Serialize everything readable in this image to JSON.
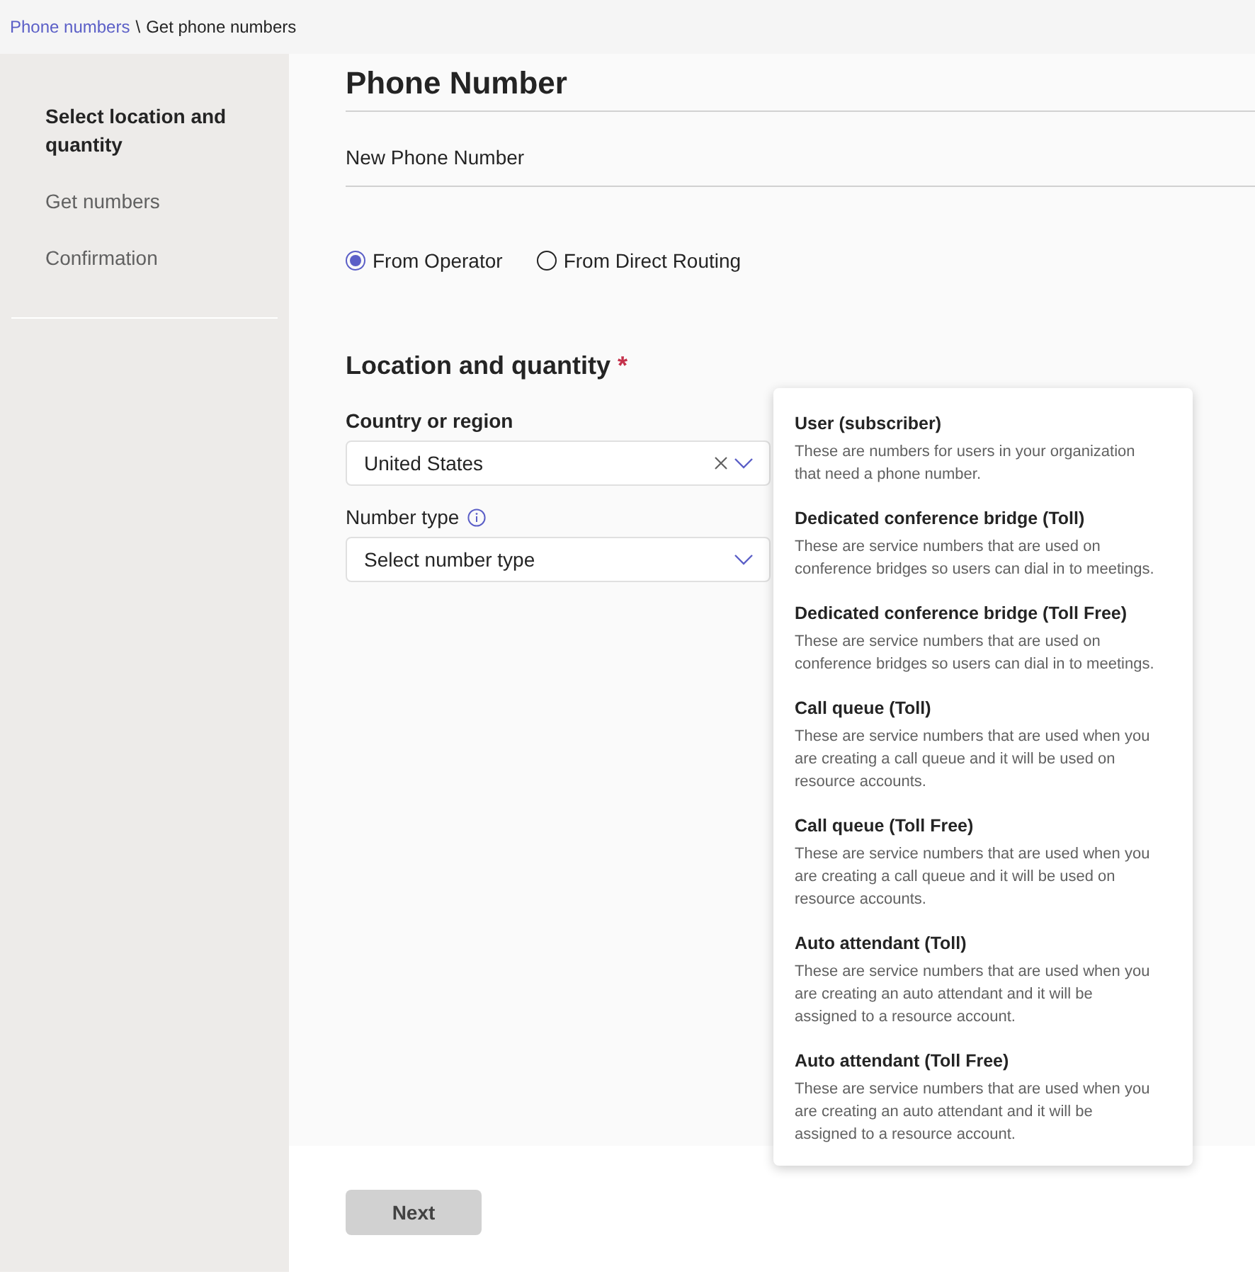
{
  "breadcrumb": {
    "link": "Phone numbers",
    "separator": "\\",
    "current": "Get phone numbers"
  },
  "steps": [
    {
      "label": "Select location and quantity",
      "selected": true
    },
    {
      "label": "Get numbers",
      "selected": false
    },
    {
      "label": "Confirmation",
      "selected": false
    }
  ],
  "page_title": "Phone Number",
  "subtitle": "New Phone Number",
  "source_options": [
    {
      "label": "From Operator",
      "selected": true
    },
    {
      "label": "From Direct Routing",
      "selected": false
    }
  ],
  "section": {
    "title": "Location and quantity",
    "required_mark": "*"
  },
  "country": {
    "label": "Country or region",
    "value": "United States"
  },
  "number_type": {
    "label": "Number type",
    "placeholder": "Select number type"
  },
  "number_type_options": [
    {
      "title": "User (subscriber)",
      "description": "These are numbers for users in your organization that need a phone number."
    },
    {
      "title": "Dedicated conference bridge (Toll)",
      "description": "These are service numbers that are used on conference bridges so users can dial in to meetings."
    },
    {
      "title": "Dedicated conference bridge (Toll Free)",
      "description": "These are service numbers that are used on conference bridges so users can dial in to meetings."
    },
    {
      "title": "Call queue (Toll)",
      "description": "These are service numbers that are used when you are creating a call queue and it will be used on resource accounts."
    },
    {
      "title": "Call queue (Toll Free)",
      "description": "These are service numbers that are used when you are creating a call queue and it will be used on resource accounts."
    },
    {
      "title": "Auto attendant (Toll)",
      "description": "These are service numbers that are used when you are creating an auto attendant and it will be assigned to a resource account."
    },
    {
      "title": "Auto attendant (Toll Free)",
      "description": "These are service numbers that are used when you are creating an auto attendant and it will be assigned to a resource account."
    }
  ],
  "next_button": {
    "label": "Next",
    "disabled": true
  }
}
